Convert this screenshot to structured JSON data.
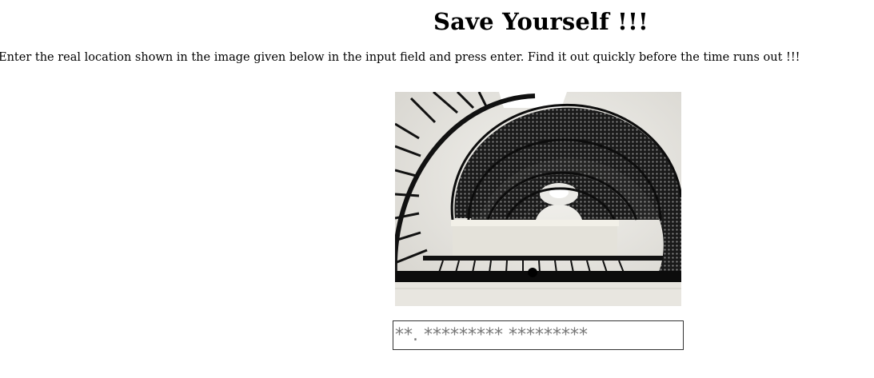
{
  "heading": {
    "title": "Save Yourself !!!",
    "instructions": "Enter the real location shown in the image given below in the input field and press enter. Find it out quickly before the time runs out !!!"
  },
  "puzzle_image": {
    "subject": "spiral-staircase-photo"
  },
  "answer": {
    "value": "",
    "placeholder": "**. ********* *********"
  }
}
